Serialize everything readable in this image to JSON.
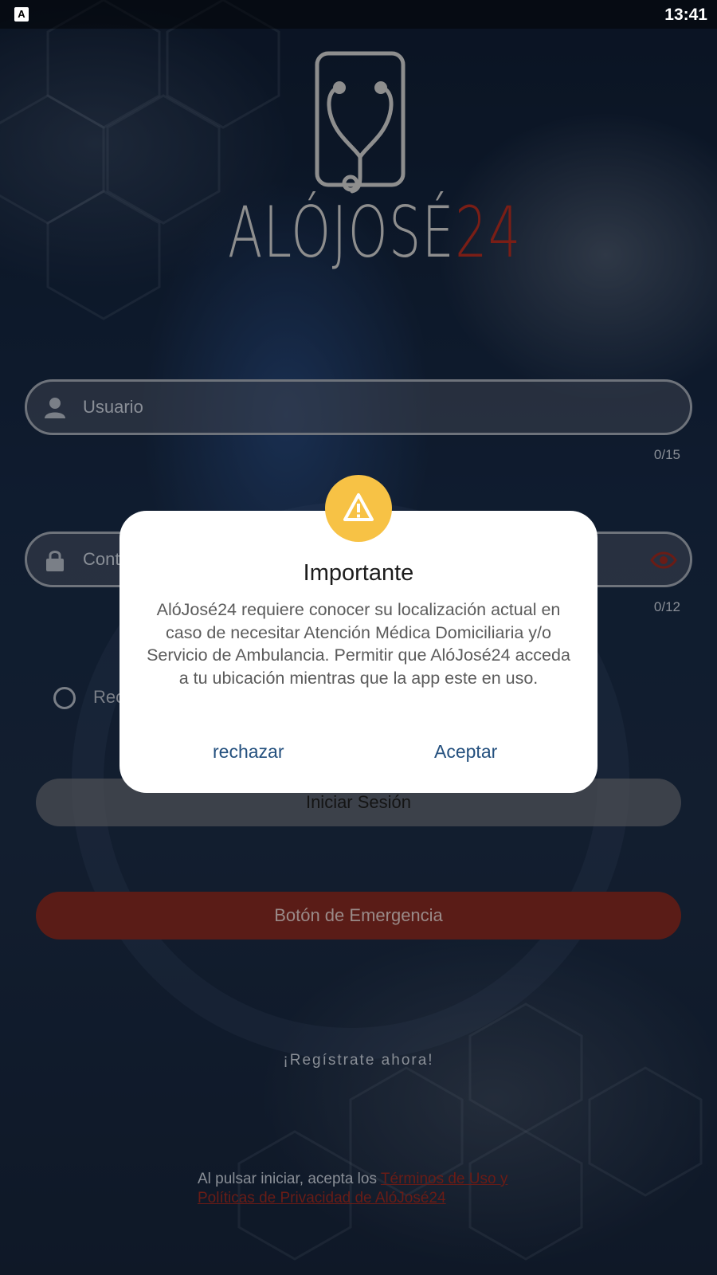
{
  "status_bar": {
    "time": "13:41",
    "notification_icon": "A"
  },
  "logo": {
    "name_main": "ALÓJOSÉ",
    "name_accent": "24",
    "icon": "phone-stethoscope-icon"
  },
  "form": {
    "username_placeholder": "Usuario",
    "username_counter": "0/15",
    "password_placeholder": "Cont",
    "password_counter": "0/12",
    "remember_label": "Rec",
    "login_label": "Iniciar Sesión",
    "emergency_label": "Botón de Emergencia",
    "register_label": "¡Regístrate ahora!",
    "terms_prefix": "Al pulsar iniciar, acepta los ",
    "terms_link": "Términos de Uso y Políticas de Privacidad de AlóJosé24"
  },
  "dialog": {
    "icon": "warning-icon",
    "title": "Importante",
    "body": "AlóJosé24 requiere conocer su localización actual en caso de necesitar Atención Médica Domiciliaria y/o Servicio de Ambulancia. Permitir que AlóJosé24 acceda a tu ubicación mientras que la app este en uso.",
    "reject_label": "rechazar",
    "accept_label": "Aceptar"
  },
  "colors": {
    "accent_red": "#7a1e16",
    "warning_yellow": "#f7c245",
    "dialog_button": "#24507e"
  }
}
